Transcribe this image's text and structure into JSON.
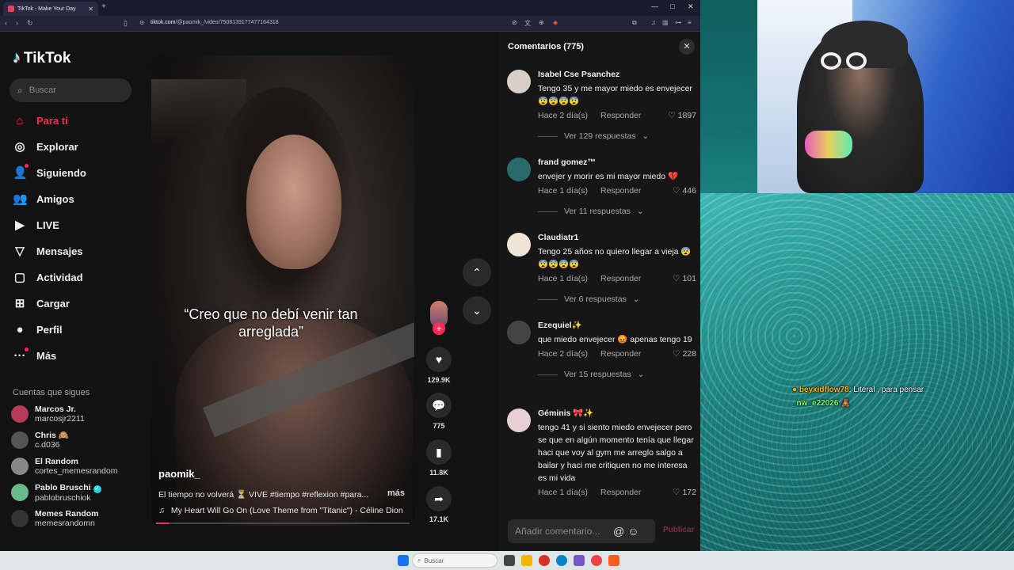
{
  "browser": {
    "tab_title": "TikTok - Make Your Day",
    "tab_close": "✕",
    "new_tab": "+",
    "url_host": "tiktok.com",
    "url_path": "/@paomik_/video/7508139177477164318",
    "window_min": "—",
    "window_max": "□",
    "window_close": "✕"
  },
  "sidebar": {
    "logo": "TikTok",
    "search_placeholder": "Buscar",
    "nav": [
      {
        "label": "Para ti",
        "icon": "home-icon"
      },
      {
        "label": "Explorar",
        "icon": "compass-icon"
      },
      {
        "label": "Siguiendo",
        "icon": "following-icon"
      },
      {
        "label": "Amigos",
        "icon": "friends-icon"
      },
      {
        "label": "LIVE",
        "icon": "live-icon"
      },
      {
        "label": "Mensajes",
        "icon": "messages-icon"
      },
      {
        "label": "Actividad",
        "icon": "activity-icon"
      },
      {
        "label": "Cargar",
        "icon": "upload-icon"
      },
      {
        "label": "Perfil",
        "icon": "profile-icon"
      },
      {
        "label": "Más",
        "icon": "more-icon"
      }
    ],
    "following_title": "Cuentas que sigues",
    "accounts": [
      {
        "name": "Marcos Jr.",
        "handle": "marcosjr2211"
      },
      {
        "name": "Chris 🙈",
        "handle": "c.d036"
      },
      {
        "name": "El Random",
        "handle": "cortes_memesrandom"
      },
      {
        "name": "Pablo Bruschi",
        "handle": "pablobruschiok"
      },
      {
        "name": "Memes Random",
        "handle": "memesrandomn"
      }
    ]
  },
  "video": {
    "caption": "“Creo que no debí venir tan arreglada”",
    "author": "paomik_",
    "description": "El tiempo no volverá ⏳ VIVE #tiempo #reflexion #para...",
    "more": "más",
    "music": "My Heart Will Go On (Love Theme from \"Titanic\") - Céline Dion",
    "progress": 0.05,
    "likes": "129.9K",
    "comments": "775",
    "saves": "11.8K",
    "shares": "17.1K"
  },
  "comments_panel": {
    "title": "Comentarios (775)",
    "close": "✕",
    "reply_label": "Responder",
    "input_placeholder": "Añadir comentario...",
    "publish": "Publicar",
    "items": [
      {
        "user": "Isabel Cse Psanchez",
        "text": "Tengo 35 y me mayor miedo es envejecer 😨😨😨😨",
        "time": "Hace 2 día(s)",
        "likes": "1897",
        "view": "Ver 129 respuestas"
      },
      {
        "user": "frand gomez™",
        "text": "envejer y morir es mi mayor miedo 💔",
        "time": "Hace 1 día(s)",
        "likes": "446",
        "view": "Ver 11 respuestas"
      },
      {
        "user": "Claudiatr1",
        "text": "Tengo 25 años no quiero llegar a vieja 😨😨😨😨😨",
        "time": "Hace 1 día(s)",
        "likes": "101",
        "view": "Ver 6 respuestas"
      },
      {
        "user": "Ezequiel✨",
        "text": "que miedo envejecer 😡 apenas tengo 19",
        "time": "Hace 2 día(s)",
        "likes": "228",
        "view": "Ver 15 respuestas"
      },
      {
        "user": "Géminis 🎀✨",
        "text": "tengo 41 y si siento miedo envejecer pero se que en algún momento tenía que llegar haci que voy al gym me arreglo salgo a bailar y haci me critiquen no me interesa es mi vida",
        "time": "Hace 1 día(s)",
        "likes": "172",
        "view": ""
      }
    ]
  },
  "chat": {
    "user1": "beyxidflow78",
    "msg1": ": Literal , para pensar",
    "user2": "_nw_e22026"
  },
  "taskbar": {
    "search_placeholder": "Buscar"
  }
}
